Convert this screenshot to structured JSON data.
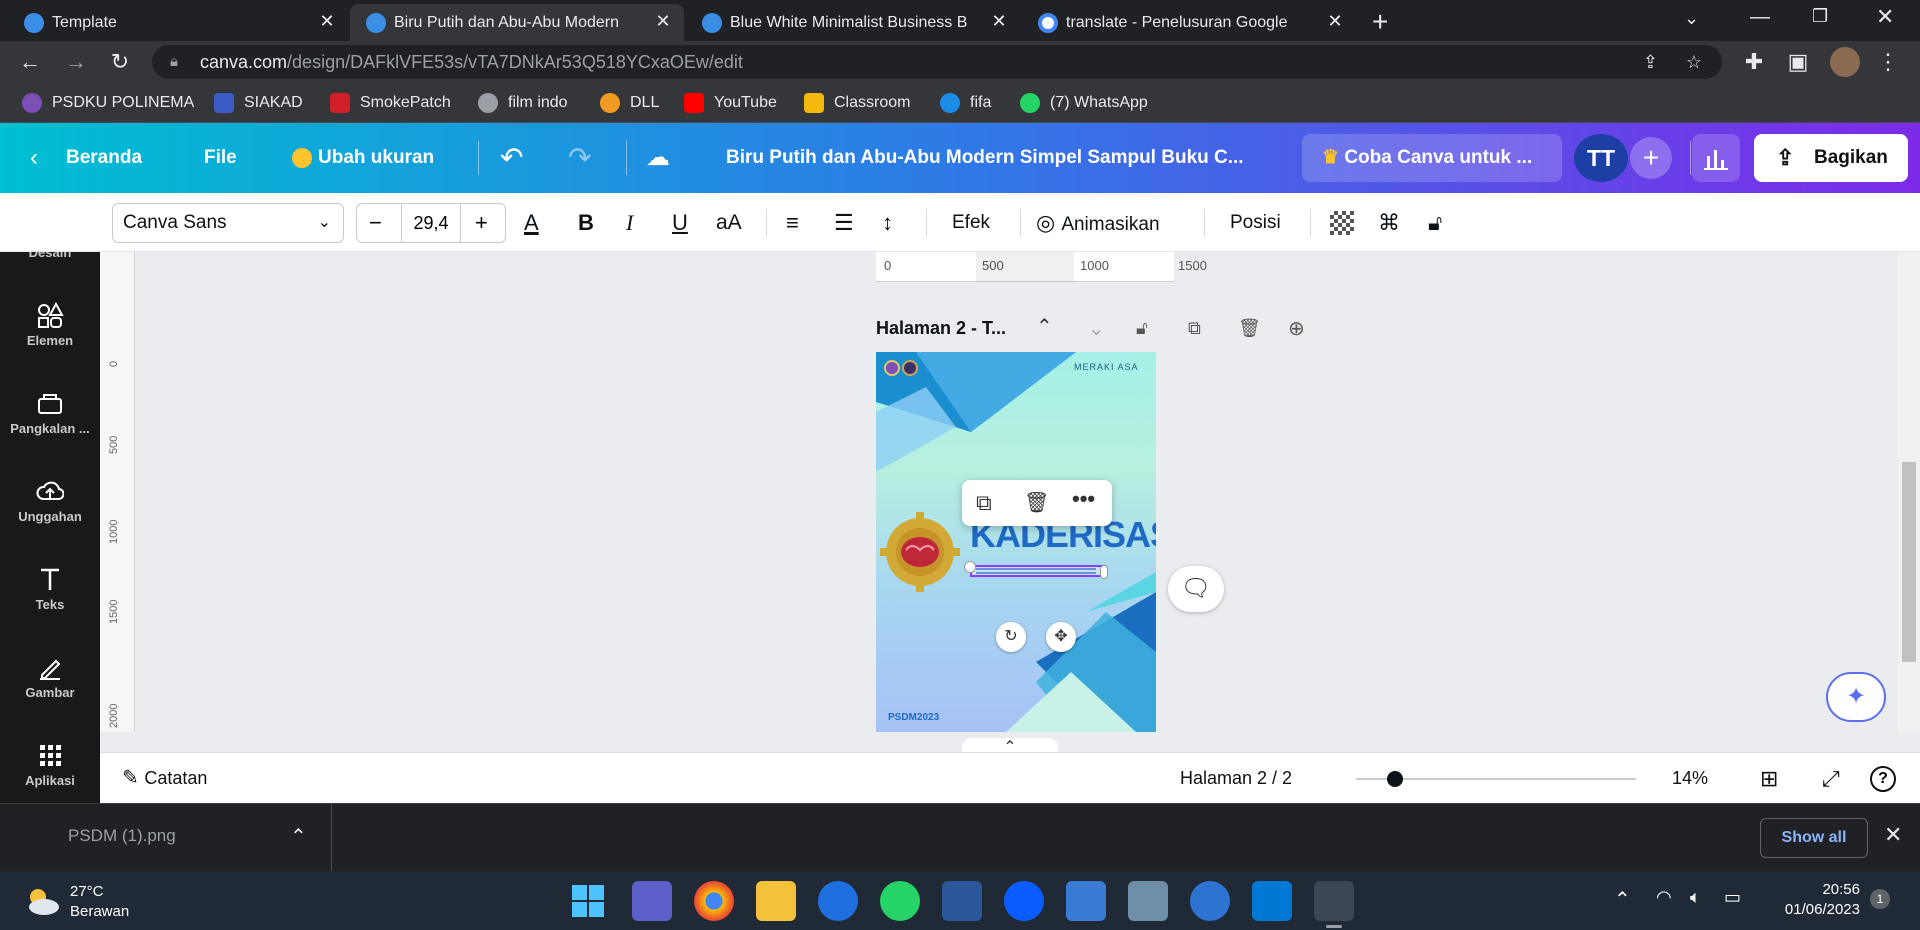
{
  "browser": {
    "tabs": [
      {
        "title": "Template",
        "active": false
      },
      {
        "title": "Biru Putih dan Abu-Abu Modern",
        "active": true
      },
      {
        "title": "Blue White Minimalist Business B",
        "active": false
      },
      {
        "title": "translate - Penelusuran Google",
        "active": false
      }
    ],
    "url_host": "canva.com",
    "url_path": "/design/DAFklVFE53s/vTA7DNkAr53Q518YCxaOEw/edit",
    "bookmarks": [
      {
        "label": "PSDKU POLINEMA",
        "color": "#7b4fb5"
      },
      {
        "label": "SIAKAD",
        "color": "#3b5cc4"
      },
      {
        "label": "SmokePatch",
        "color": "#d11f2a"
      },
      {
        "label": "film indo",
        "color": "#9aa0a6"
      },
      {
        "label": "DLL",
        "color": "#f29b23"
      },
      {
        "label": "YouTube",
        "color": "#ff0000"
      },
      {
        "label": "Classroom",
        "color": "#f3b90d"
      },
      {
        "label": "fifa",
        "color": "#1c8de6"
      },
      {
        "label": "(7) WhatsApp",
        "color": "#25d366"
      }
    ]
  },
  "canva": {
    "header": {
      "back_label": "Beranda",
      "file_label": "File",
      "resize_label": "Ubah ukuran",
      "design_title": "Biru Putih dan Abu-Abu Modern Simpel Sampul Buku C...",
      "try_pro_label": "Coba Canva untuk ...",
      "avatar_initials": "TT",
      "share_label": "Bagikan"
    },
    "toolbar": {
      "font_family": "Canva Sans",
      "font_size": "29,4",
      "effects_label": "Efek",
      "animate_label": "Animasikan",
      "position_label": "Posisi"
    },
    "sidebar": [
      {
        "label": "Desain"
      },
      {
        "label": "Elemen"
      },
      {
        "label": "Pangkalan ..."
      },
      {
        "label": "Unggahan"
      },
      {
        "label": "Teks"
      },
      {
        "label": "Gambar"
      },
      {
        "label": "Aplikasi"
      }
    ],
    "ruler": {
      "h_ticks": [
        "0",
        "500",
        "1000",
        "1500"
      ],
      "v_ticks": [
        "0",
        "500",
        "1000",
        "1500",
        "2000"
      ]
    },
    "page": {
      "page_label": "Halaman 2 - T...",
      "brand_text": "MERAKI ASA",
      "heading": "KADERISASI",
      "footer": "PSDM2023"
    },
    "bottom": {
      "notes_label": "Catatan",
      "page_indicator": "Halaman 2 / 2",
      "zoom_value": 14,
      "zoom_label": "14%"
    }
  },
  "downloads": {
    "file_name": "PSDM (1).png",
    "show_all_label": "Show all"
  },
  "taskbar": {
    "weather_temp": "27°C",
    "weather_desc": "Berawan",
    "time": "20:56",
    "date": "01/06/2023",
    "notification_count": "1"
  },
  "colors": {
    "canva_gradient_start": "#00bfd2",
    "canva_gradient_end": "#7d2ae8",
    "heading_blue": "#1e6ac6",
    "selection_purple": "#8b3dff"
  }
}
